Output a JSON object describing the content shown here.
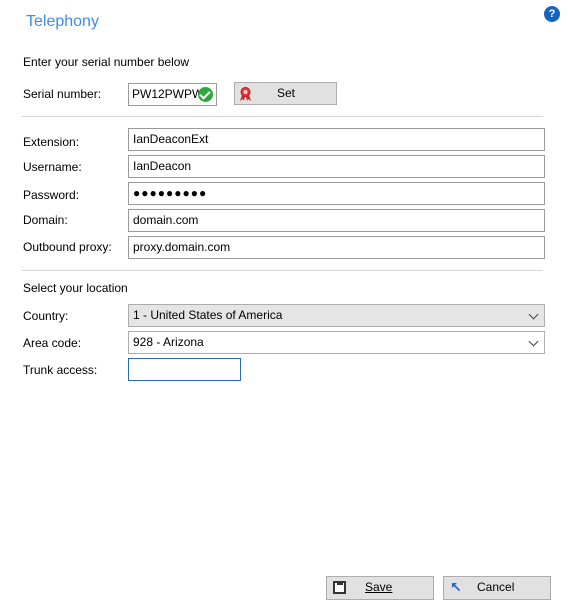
{
  "header": {
    "title": "Telephony",
    "help_glyph": "?"
  },
  "serial": {
    "intro": "Enter your serial number below",
    "label": "Serial number:",
    "value": "PW12PWPW",
    "status_icon": "check-icon",
    "set_button": "Set"
  },
  "account": {
    "extension": {
      "label": "Extension:",
      "value": "IanDeaconExt"
    },
    "username": {
      "label": "Username:",
      "value": "IanDeacon"
    },
    "password": {
      "label": "Password:",
      "value": "●●●●●●●●●"
    },
    "domain": {
      "label": "Domain:",
      "value": "domain.com"
    },
    "outbound_proxy": {
      "label": "Outbound proxy:",
      "value": "proxy.domain.com"
    }
  },
  "location": {
    "heading": "Select your location",
    "country": {
      "label": "Country:",
      "value": "1 - United States of America"
    },
    "area_code": {
      "label": "Area code:",
      "value": "928 - Arizona"
    },
    "trunk_access": {
      "label": "Trunk access:",
      "value": ""
    }
  },
  "footer": {
    "save_label": "Save",
    "cancel_label": "Cancel"
  },
  "colors": {
    "title": "#3a8ee6",
    "help": "#1565c0",
    "check": "#2eaa3c",
    "focus_border": "#2b6cb8"
  }
}
